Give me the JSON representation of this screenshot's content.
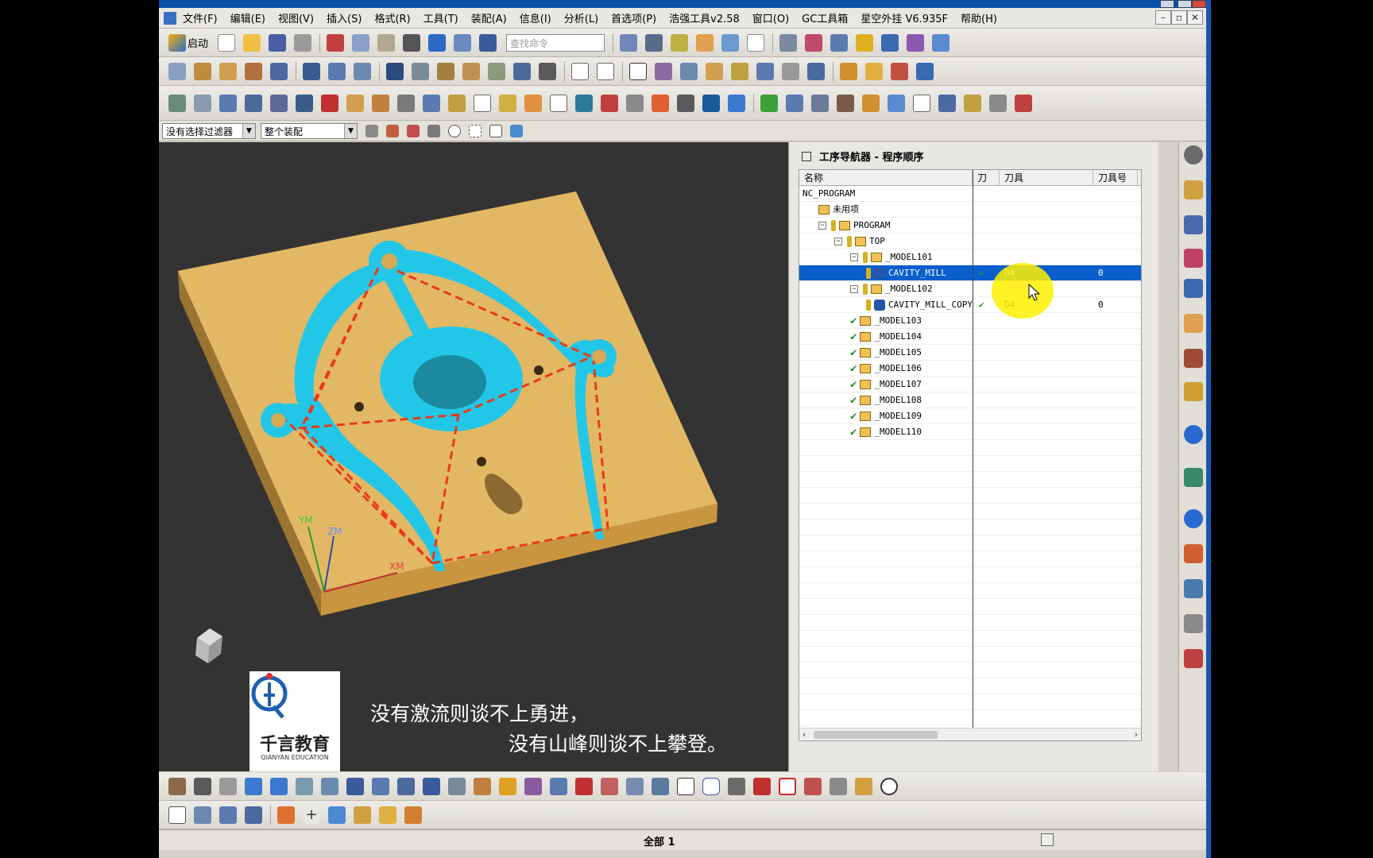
{
  "menu": [
    "文件(F)",
    "编辑(E)",
    "视图(V)",
    "插入(S)",
    "格式(R)",
    "工具(T)",
    "装配(A)",
    "信息(I)",
    "分析(L)",
    "首选项(P)",
    "浩强工具v2.58",
    "窗口(O)",
    "GC工具箱",
    "星空外挂 V6.935F",
    "帮助(H)"
  ],
  "toolbar": {
    "start_label": "启动",
    "search_placeholder": "查找命令"
  },
  "filter": {
    "selection_filter": "没有选择过滤器",
    "scope": "整个装配"
  },
  "viewport": {
    "axes": {
      "ym": "YM",
      "zm": "ZM",
      "xm": "XM"
    },
    "subtitle_line1": "没有激流则谈不上勇进，",
    "subtitle_line2": "没有山峰则谈不上攀登。",
    "logo_cn": "千言教育",
    "logo_en": "QIANYAN EDUCATION"
  },
  "navigator": {
    "title": "工序导航器 - 程序顺序",
    "columns": [
      "名称",
      "刀",
      "刀具",
      "刀具号"
    ],
    "rows": [
      {
        "name": "NC_PROGRAM",
        "indent": 0,
        "icon": "none",
        "tool": "",
        "tool_no": ""
      },
      {
        "name": "未用项",
        "indent": 1,
        "icon": "folder",
        "tool": "",
        "tool_no": ""
      },
      {
        "name": "PROGRAM",
        "indent": 1,
        "icon": "key-folder",
        "tool": "",
        "tool_no": ""
      },
      {
        "name": "TOP",
        "indent": 2,
        "icon": "key-folder",
        "tool": "",
        "tool_no": ""
      },
      {
        "name": "_MODEL101",
        "indent": 3,
        "icon": "key-folder",
        "tool": "",
        "tool_no": ""
      },
      {
        "name": "CAVITY_MILL",
        "indent": 4,
        "icon": "key-op",
        "tool": "D4",
        "tool_no": "0",
        "check": true,
        "selected": true
      },
      {
        "name": "_MODEL102",
        "indent": 3,
        "icon": "key-folder",
        "tool": "",
        "tool_no": ""
      },
      {
        "name": "CAVITY_MILL_COPY",
        "indent": 4,
        "icon": "key-op",
        "tool": "D4",
        "tool_no": "0",
        "check": true
      },
      {
        "name": "_MODEL103",
        "indent": 3,
        "icon": "check-folder",
        "tool": "",
        "tool_no": ""
      },
      {
        "name": "_MODEL104",
        "indent": 3,
        "icon": "check-folder",
        "tool": "",
        "tool_no": ""
      },
      {
        "name": "_MODEL105",
        "indent": 3,
        "icon": "check-folder",
        "tool": "",
        "tool_no": ""
      },
      {
        "name": "_MODEL106",
        "indent": 3,
        "icon": "check-folder",
        "tool": "",
        "tool_no": ""
      },
      {
        "name": "_MODEL107",
        "indent": 3,
        "icon": "check-folder",
        "tool": "",
        "tool_no": ""
      },
      {
        "name": "_MODEL108",
        "indent": 3,
        "icon": "check-folder",
        "tool": "",
        "tool_no": ""
      },
      {
        "name": "_MODEL109",
        "indent": 3,
        "icon": "check-folder",
        "tool": "",
        "tool_no": ""
      },
      {
        "name": "_MODEL110",
        "indent": 3,
        "icon": "check-folder",
        "tool": "",
        "tool_no": ""
      }
    ]
  },
  "status": {
    "text": "全部 1"
  },
  "colors": {
    "part": "#e3b864",
    "toolpath": "#22c7e8",
    "selection": "#0a5fcc",
    "highlight": "#fff000"
  }
}
